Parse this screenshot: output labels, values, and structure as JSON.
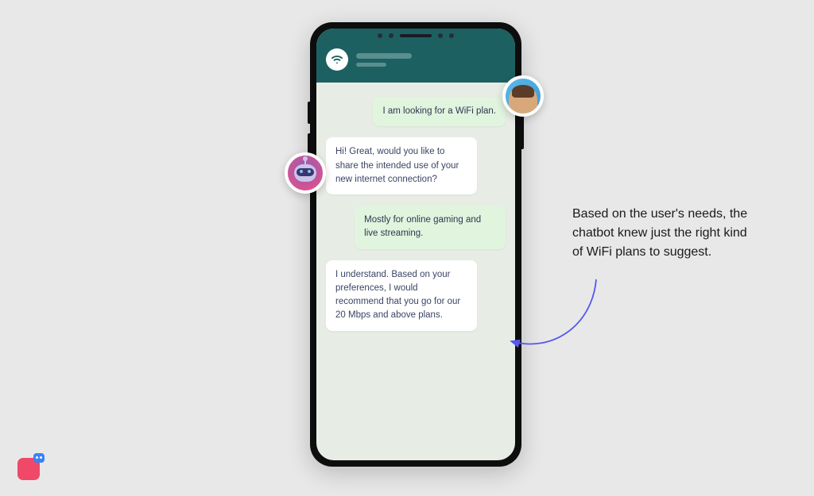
{
  "chat": {
    "messages": [
      {
        "role": "user",
        "text": "I am looking for a WiFi plan."
      },
      {
        "role": "bot",
        "text": "Hi! Great, would you like to share the intended use of your new internet connection?"
      },
      {
        "role": "user",
        "text": "Mostly for online gaming and live streaming."
      },
      {
        "role": "bot",
        "text": "I understand. Based on your preferences, I would recommend that you go for our 20 Mbps and above plans."
      }
    ]
  },
  "caption": "Based on the user's needs, the chatbot knew just the right kind of WiFi plans to suggest.",
  "avatars": {
    "user": "user-avatar",
    "bot": "robot-avatar"
  },
  "colors": {
    "header": "#1d6062",
    "user_bubble": "#e1f4de",
    "bot_bubble": "#ffffff",
    "arrow": "#5558f0"
  }
}
